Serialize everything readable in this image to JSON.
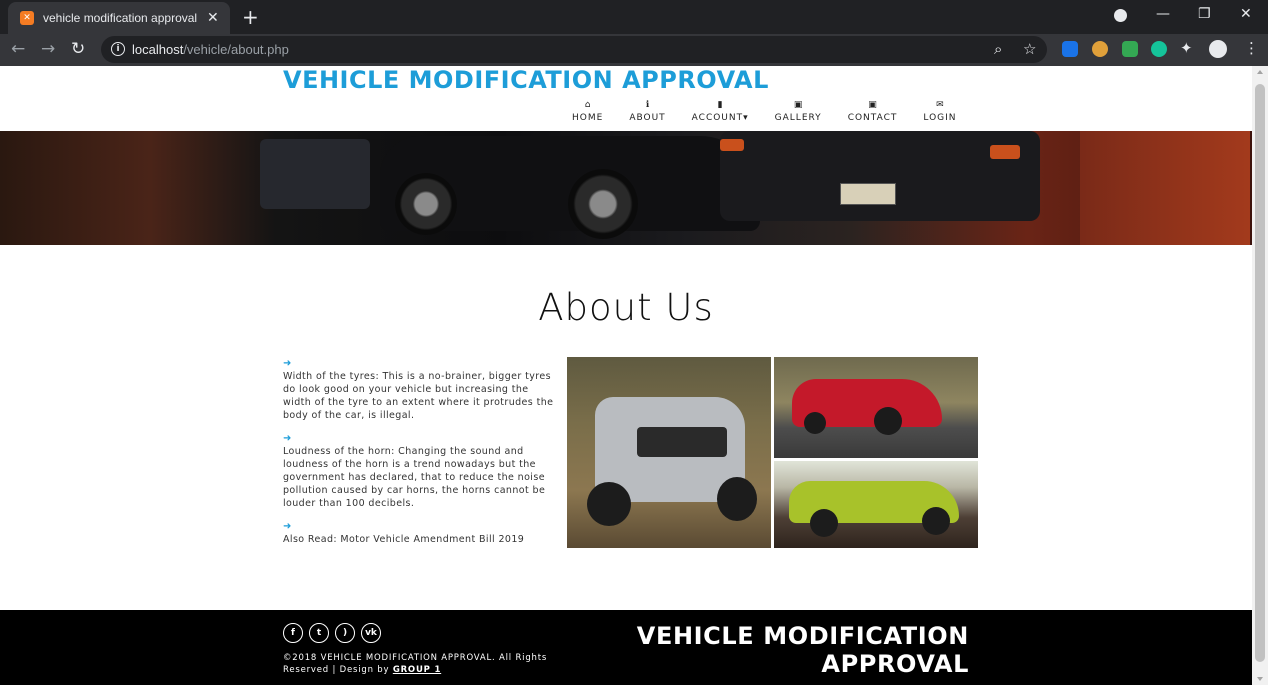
{
  "browser": {
    "tab_title": "vehicle modification approval",
    "url_host": "localhost",
    "url_path": "/vehicle/about.php"
  },
  "site": {
    "title": "VEHICLE MODIFICATION APPROVAL",
    "nav": [
      {
        "label": "HOME",
        "icon": "home-icon"
      },
      {
        "label": "ABOUT",
        "icon": "info-icon"
      },
      {
        "label": "ACCOUNT",
        "icon": "file-icon"
      },
      {
        "label": "GALLERY",
        "icon": "image-icon"
      },
      {
        "label": "CONTACT",
        "icon": "image-icon"
      },
      {
        "label": "LOGIN",
        "icon": "envelope-icon"
      }
    ]
  },
  "about": {
    "heading": "About Us",
    "points": [
      "Width of the tyres: This is a no-brainer, bigger tyres do look good on your vehicle but increasing the width of the tyre to an extent where it protrudes the body of the car, is illegal.",
      "Loudness of the horn: Changing the sound and loudness of the horn is a trend nowadays but the government has declared, that to reduce the noise pollution caused by car horns, the horns cannot be louder than 100 decibels.",
      "Also Read: Motor Vehicle Amendment Bill 2019"
    ]
  },
  "footer": {
    "copyright_prefix": "©2018 VEHICLE MODIFICATION APPROVAL. All Rights Reserved | Design by ",
    "designer": "GROUP 1",
    "brand_line1": "VEHICLE MODIFICATION",
    "brand_line2": "APPROVAL",
    "socials": [
      "facebook-icon",
      "twitter-icon",
      "rss-icon",
      "vk-icon"
    ]
  },
  "colors": {
    "accent": "#1d9dd8",
    "footer_bg": "#000000"
  }
}
